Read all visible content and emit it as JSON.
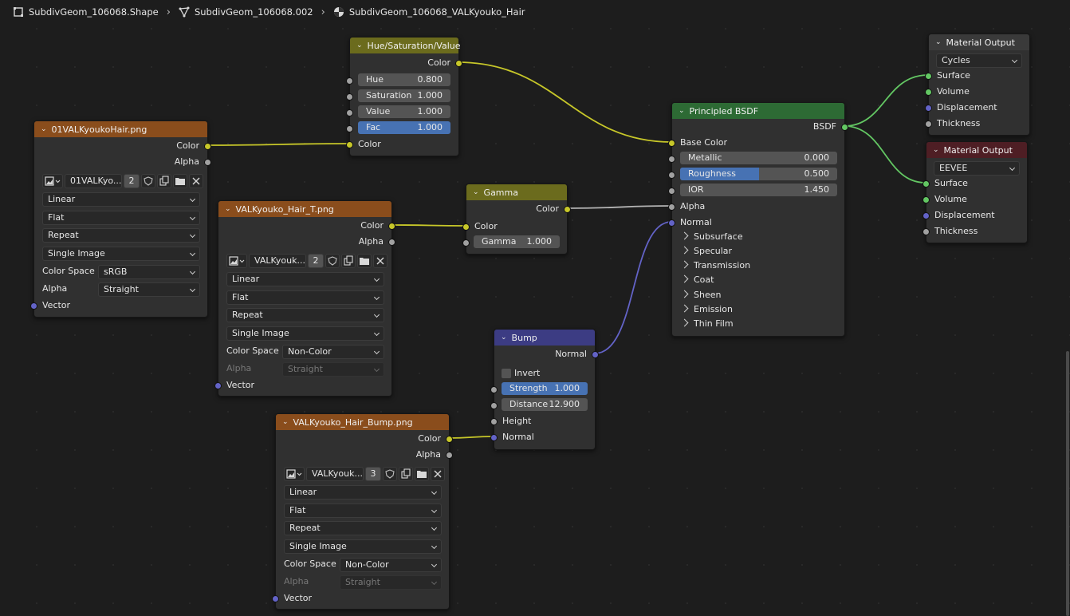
{
  "breadcrumb": [
    "SubdivGeom_106068.Shape",
    "SubdivGeom_106068.002",
    "SubdivGeom_106068_VALKyouko_Hair"
  ],
  "colors": {
    "texture_header": "#8a4d1c",
    "color_header": "#6b6b1d",
    "shader_header": "#2d6a34",
    "vector_header": "#3c3c83",
    "output_header": "#4e1e24",
    "socket_color": "#c7c729",
    "socket_float": "#a1a1a1",
    "socket_vector": "#6363c7",
    "socket_shader": "#63c763",
    "accent": "#4772b3"
  },
  "icons": {
    "mesh": "mesh-icon",
    "modifier": "geometry-icon",
    "material": "material-icon",
    "image": "image-icon",
    "shield": "shield-icon",
    "duplicate": "duplicate-icon",
    "folder": "folder-icon",
    "close": "close-icon"
  },
  "hsv": {
    "title": "Hue/Saturation/Value",
    "out_color": "Color",
    "hue_label": "Hue",
    "hue": "0.800",
    "sat_label": "Saturation",
    "sat": "1.000",
    "val_label": "Value",
    "val": "1.000",
    "fac_label": "Fac",
    "fac": "1.000",
    "in_color": "Color"
  },
  "tex1": {
    "title": "01VALKyoukoHair.png",
    "out_color": "Color",
    "out_alpha": "Alpha",
    "image_name": "01VALKyo...",
    "users": "2",
    "interp": "Linear",
    "proj": "Flat",
    "ext": "Repeat",
    "source": "Single Image",
    "cs_label": "Color Space",
    "cs": "sRGB",
    "alpha_label": "Alpha",
    "alpha": "Straight",
    "vector": "Vector"
  },
  "tex2": {
    "title": "VALKyouko_Hair_T.png",
    "out_color": "Color",
    "out_alpha": "Alpha",
    "image_name": "VALKyouk...",
    "users": "2",
    "interp": "Linear",
    "proj": "Flat",
    "ext": "Repeat",
    "source": "Single Image",
    "cs_label": "Color Space",
    "cs": "Non-Color",
    "alpha_label": "Alpha",
    "alpha": "Straight",
    "vector": "Vector"
  },
  "tex3": {
    "title": "VALKyouko_Hair_Bump.png",
    "out_color": "Color",
    "out_alpha": "Alpha",
    "image_name": "VALKyouk...",
    "users": "3",
    "interp": "Linear",
    "proj": "Flat",
    "ext": "Repeat",
    "source": "Single Image",
    "cs_label": "Color Space",
    "cs": "Non-Color",
    "alpha_label": "Alpha",
    "alpha": "Straight",
    "vector": "Vector"
  },
  "gamma": {
    "title": "Gamma",
    "out_color": "Color",
    "in_color": "Color",
    "gamma_label": "Gamma",
    "gamma": "1.000"
  },
  "bump": {
    "title": "Bump",
    "out_normal": "Normal",
    "invert": "Invert",
    "strength_label": "Strength",
    "strength": "1.000",
    "distance_label": "Distance",
    "distance": "12.900",
    "height": "Height",
    "normal": "Normal"
  },
  "bsdf": {
    "title": "Principled BSDF",
    "out": "BSDF",
    "base_color": "Base Color",
    "metallic_label": "Metallic",
    "metallic": "0.000",
    "roughness_label": "Roughness",
    "roughness": "0.500",
    "roughness_fraction": 0.5,
    "ior_label": "IOR",
    "ior": "1.450",
    "alpha": "Alpha",
    "normal": "Normal",
    "panels": [
      "Subsurface",
      "Specular",
      "Transmission",
      "Coat",
      "Sheen",
      "Emission",
      "Thin Film"
    ]
  },
  "out1": {
    "title": "Material Output",
    "target": "Cycles",
    "surface": "Surface",
    "volume": "Volume",
    "displacement": "Displacement",
    "thickness": "Thickness"
  },
  "out2": {
    "title": "Material Output",
    "target": "EEVEE",
    "surface": "Surface",
    "volume": "Volume",
    "displacement": "Displacement",
    "thickness": "Thickness"
  }
}
